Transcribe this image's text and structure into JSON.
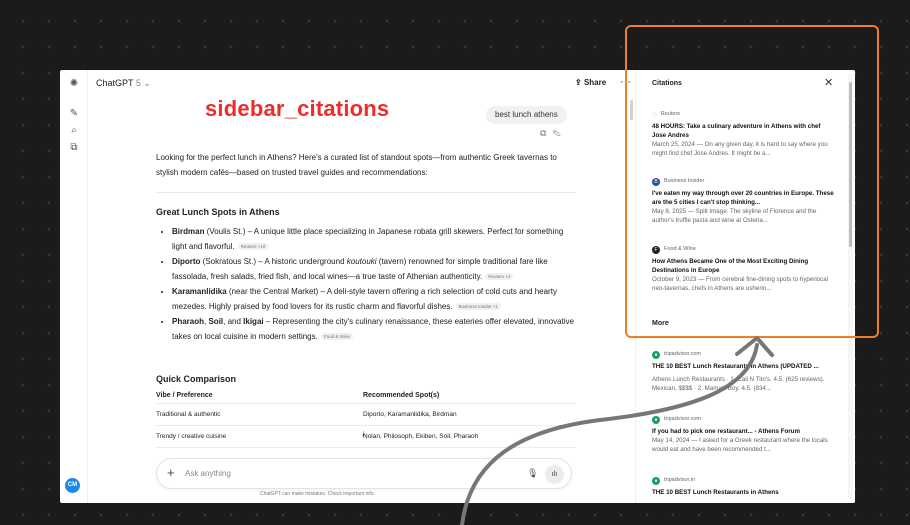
{
  "annotation_label": "sidebar_citations",
  "header": {
    "app_title": "ChatGPT",
    "model_version": "5",
    "share_label": "Share"
  },
  "query": "best lunch athens",
  "intro": "Looking for the perfect lunch in Athens? Here's a curated list of standout spots—from authentic Greek tavernas to stylish modern cafés—based on trusted travel guides and recommendations:",
  "section_title": "Great Lunch Spots in Athens",
  "items": [
    {
      "name": "Birdman",
      "rest": " (Voulis St.) – A unique little place specializing in Japanese robata grill skewers. Perfect for something light and flavorful.",
      "badge": "Reuters +10"
    },
    {
      "name": "Diporto",
      "rest": " (Sokratous St.) – A historic underground ",
      "em": "koutouki",
      "rest2": " (tavern) renowned for simple traditional fare like fassolada, fresh salads, fried fish, and local wines—a true taste of Athenian authenticity.",
      "badge": "Reuters +2"
    },
    {
      "name": "Karamanlidika",
      "rest": " (near the Central Market) – A deli-style tavern offering a rich selection of cold cuts and hearty mezedes. Highly praised by food lovers for its rustic charm and flavorful dishes.",
      "badge": "Business Insider +1"
    },
    {
      "name": "Pharaoh",
      "rest": ", ",
      "name2": "Soil",
      "rest2": ", and ",
      "name3": "Ikigai",
      "rest3": " – Representing the city's culinary renaissance, these eateries offer elevated, innovative takes on local cuisine in modern settings.",
      "badge": "Food & Wine"
    }
  ],
  "comparison": {
    "title": "Quick Comparison",
    "headers": [
      "Vibe / Preference",
      "Recommended Spot(s)"
    ],
    "rows": [
      [
        "Traditional & authentic",
        "Diporto, Karamanlidika, Birdman"
      ],
      [
        "Trendy / creative cuisine",
        "Nolan, Philosoph, Ekiben, Soil, Pharaoh"
      ]
    ]
  },
  "composer": {
    "placeholder": "Ask anything"
  },
  "disclaimer": "ChatGPT can make mistakes. Check important info.",
  "avatar_initials": "CM",
  "citations": {
    "title": "Citations",
    "items": [
      {
        "source": "Reuters",
        "title": "48 HOURS: Take a culinary adventure in Athens with chef Jose Andres",
        "snippet": "March 25, 2024 — On any given day, it is hard to say where you might find chef Jose Andres. It might be a..."
      },
      {
        "source": "Business Insider",
        "title": "I've eaten my way through over 20 countries in Europe. These are the 5 cities I can't stop thinking...",
        "snippet": "May 8, 2025 — Split Image: The skyline of Florence and the author's truffle pasta and wine at Osteria..."
      },
      {
        "source": "Food & Wine",
        "title": "How Athens Became One of the Most Exciting Dining Destinations in Europe",
        "snippet": "October 9, 2023 — From cerebral fine-dining spots to hyperlocal neo-tavernas, chefs in Athens are usherin..."
      }
    ],
    "more_label": "More",
    "more_items": [
      {
        "source": "tripadvisor.com",
        "title": "THE 10 BEST Lunch Restaurants in Athens (UPDATED ...",
        "snippet": "Athens Lunch Restaurants · 1. Cali N Tito's. 4.5. (625 reviews). Mexican, $$$$ · 2. Mama's Boy. 4.5. (834..."
      },
      {
        "source": "tripadvisor.com",
        "title": "If you had to pick one restaurant... - Athens Forum",
        "snippet": "May 14, 2024 — I asked for a Greek restaurant where the locals would eat and have been recommended t..."
      },
      {
        "source": "tripadvisor.in",
        "title": "THE 10 BEST Lunch Restaurants in Athens",
        "snippet": ""
      }
    ]
  },
  "colors": {
    "highlight": "#f07d2a",
    "label": "#f02b2b",
    "background": "#1b1b1b"
  }
}
